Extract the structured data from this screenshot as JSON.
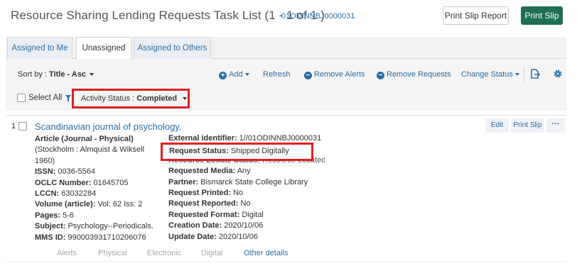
{
  "header": {
    "title": "Resource Sharing Lending Requests Task List (1 - 1 of 1 )",
    "code": "01ODINNBJ0000031",
    "print_slip_report": "Print Slip Report",
    "print_slip": "Print Slip"
  },
  "tabs": [
    {
      "label": "Assigned to Me"
    },
    {
      "label": "Unassigned"
    },
    {
      "label": "Assigned to Others"
    }
  ],
  "toolbar": {
    "sort_prefix": "Sort by : ",
    "sort_value": "Title - Asc",
    "add": "Add",
    "refresh": "Refresh",
    "remove_alerts": "Remove Alerts",
    "remove_requests": "Remove Requests",
    "change_status": "Change Status",
    "select_all": "Select All",
    "filter_prefix": "Activity Status : ",
    "filter_value": "Completed"
  },
  "record": {
    "number": "1",
    "title": "Scandinavian journal of psychology.",
    "edit": "Edit",
    "print_slip": "Print Slip",
    "more": "···",
    "left": {
      "type": "Article (Journal - Physical)",
      "publisher": "(Stockholm : Almquist & Wiksell 1960)",
      "issn_label": "ISSN:",
      "issn": "0036-5564",
      "oclc_label": "OCLC Number:",
      "oclc": "01645705",
      "lccn_label": "LCCN:",
      "lccn": "63032284",
      "volume_label": "Volume (article):",
      "volume": "Vol: 62 Iss: 2",
      "pages_label": "Pages:",
      "pages": "5-6",
      "subject_label": "Subject:",
      "subject": "Psychology--Periodicals.",
      "mms_label": "MMS ID:",
      "mms": "990003931710206076"
    },
    "right": {
      "external_label": "External identifier:",
      "external": "1//01ODINNBJ0000031",
      "request_status_label": "Request Status:",
      "request_status": "Shipped Digitally",
      "locate_label": "Resource Locate Status:",
      "locate": "Resource Located",
      "media_label": "Requested Media:",
      "media": "Any",
      "partner_label": "Partner:",
      "partner": "Bismarck State College Library",
      "printed_label": "Request Printed:",
      "printed": "No",
      "reported_label": "Request Reported:",
      "reported": "No",
      "format_label": "Requested Format:",
      "format": "Digital",
      "creation_label": "Creation Date:",
      "creation": "2020/10/06",
      "update_label": "Update Date:",
      "update": "2020/10/06"
    },
    "sub_tabs": [
      "Alerts",
      "Physical",
      "Electronic",
      "Digital",
      "Other details"
    ]
  }
}
